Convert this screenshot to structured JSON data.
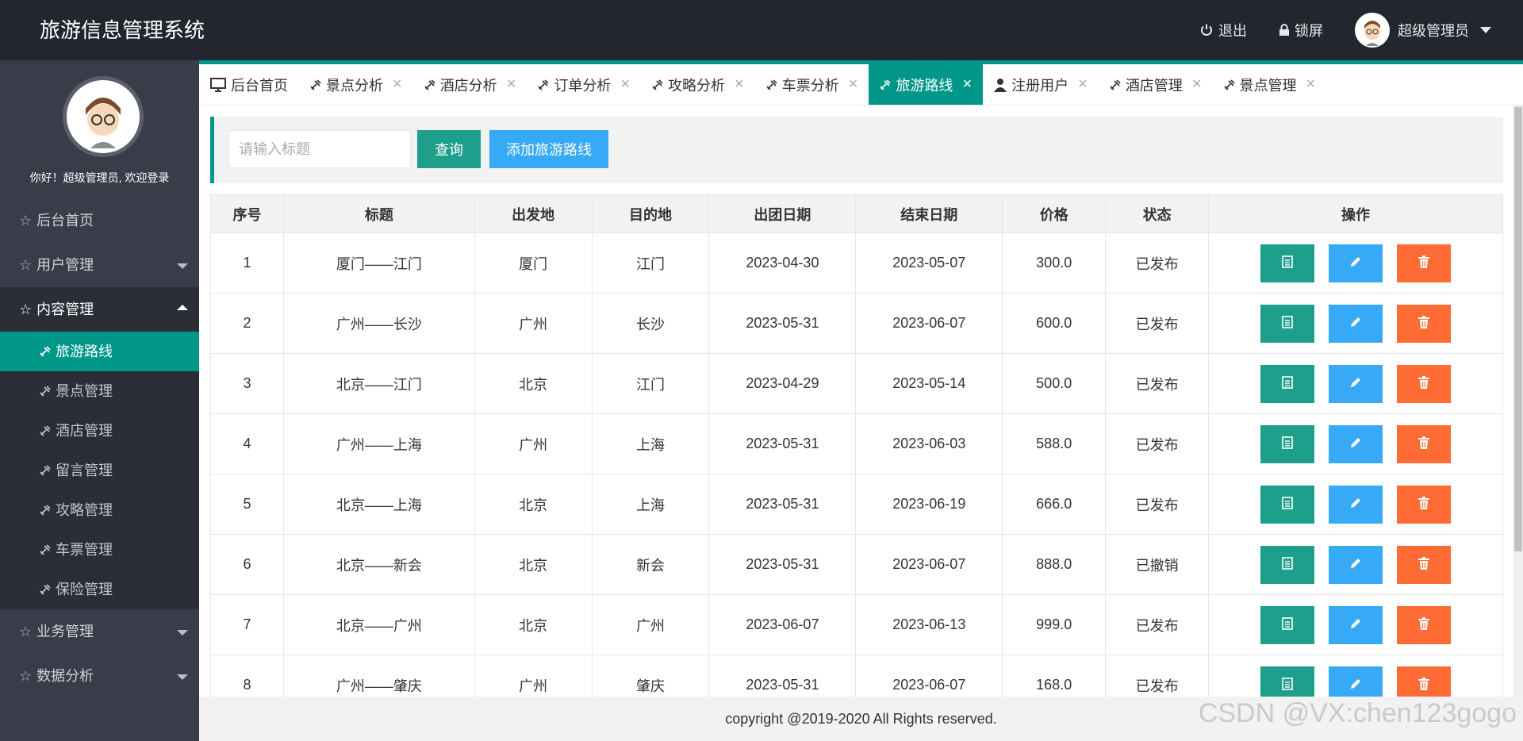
{
  "header": {
    "brand": "旅游信息管理系统",
    "logout": "退出",
    "lock": "锁屏",
    "user": "超级管理员"
  },
  "sidebar": {
    "welcome": "你好！超级管理员, 欢迎登录",
    "items": [
      {
        "label": "后台首页"
      },
      {
        "label": "用户管理"
      },
      {
        "label": "内容管理"
      },
      {
        "label": "业务管理"
      },
      {
        "label": "数据分析"
      }
    ],
    "sub": [
      {
        "label": "旅游路线"
      },
      {
        "label": "景点管理"
      },
      {
        "label": "酒店管理"
      },
      {
        "label": "留言管理"
      },
      {
        "label": "攻略管理"
      },
      {
        "label": "车票管理"
      },
      {
        "label": "保险管理"
      }
    ]
  },
  "tabs": [
    {
      "label": "后台首页"
    },
    {
      "label": "景点分析"
    },
    {
      "label": "酒店分析"
    },
    {
      "label": "订单分析"
    },
    {
      "label": "攻略分析"
    },
    {
      "label": "车票分析"
    },
    {
      "label": "旅游路线"
    },
    {
      "label": "注册用户"
    },
    {
      "label": "酒店管理"
    },
    {
      "label": "景点管理"
    }
  ],
  "search": {
    "placeholder": "请输入标题",
    "query_label": "查询",
    "add_label": "添加旅游路线"
  },
  "table": {
    "headers": [
      "序号",
      "标题",
      "出发地",
      "目的地",
      "出团日期",
      "结束日期",
      "价格",
      "状态",
      "操作"
    ],
    "rows": [
      [
        "1",
        "厦门——江门",
        "厦门",
        "江门",
        "2023-04-30",
        "2023-05-07",
        "300.0",
        "已发布"
      ],
      [
        "2",
        "广州——长沙",
        "广州",
        "长沙",
        "2023-05-31",
        "2023-06-07",
        "600.0",
        "已发布"
      ],
      [
        "3",
        "北京——江门",
        "北京",
        "江门",
        "2023-04-29",
        "2023-05-14",
        "500.0",
        "已发布"
      ],
      [
        "4",
        "广州——上海",
        "广州",
        "上海",
        "2023-05-31",
        "2023-06-03",
        "588.0",
        "已发布"
      ],
      [
        "5",
        "北京——上海",
        "北京",
        "上海",
        "2023-05-31",
        "2023-06-19",
        "666.0",
        "已发布"
      ],
      [
        "6",
        "北京——新会",
        "北京",
        "新会",
        "2023-05-31",
        "2023-06-07",
        "888.0",
        "已撤销"
      ],
      [
        "7",
        "北京——广州",
        "北京",
        "广州",
        "2023-06-07",
        "2023-06-13",
        "999.0",
        "已发布"
      ],
      [
        "8",
        "广州——肇庆",
        "广州",
        "肇庆",
        "2023-05-31",
        "2023-06-07",
        "168.0",
        "已发布"
      ]
    ]
  },
  "footer": "copyright @2019-2020 All Rights reserved.",
  "watermark": "CSDN @VX:chen123gogo",
  "colors": {
    "accent": "#009688",
    "header": "#23262e",
    "sidebar": "#393d49",
    "edit": "#36a9f7",
    "delete": "#ff6b35"
  }
}
